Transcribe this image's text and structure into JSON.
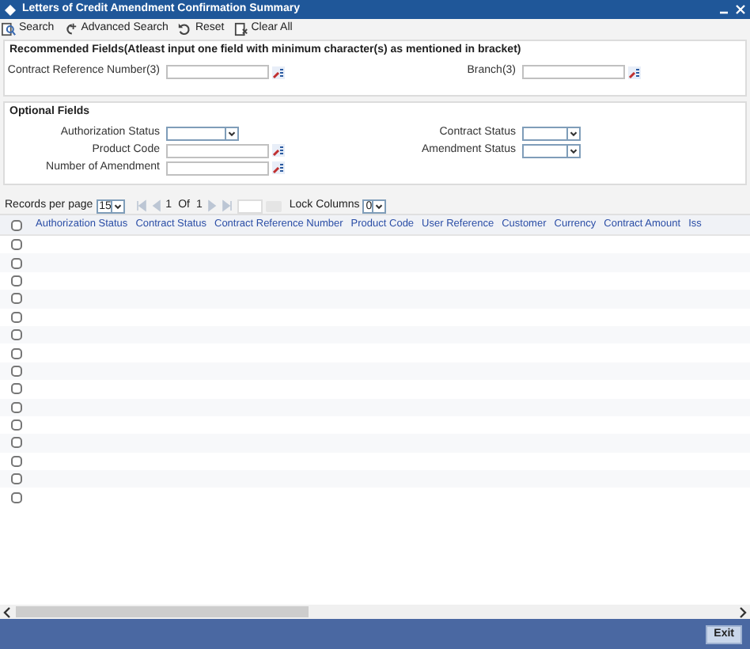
{
  "window": {
    "title": "Letters of Credit Amendment Confirmation Summary"
  },
  "toolbar": [
    {
      "label": "Search",
      "kind": "search"
    },
    {
      "label": "Advanced Search",
      "kind": "advanced"
    },
    {
      "label": "Reset",
      "kind": "reset"
    },
    {
      "label": "Clear All",
      "kind": "clear"
    }
  ],
  "recommended": {
    "title": "Recommended Fields(Atleast input one field with minimum character(s) as mentioned in bracket)",
    "left": [
      {
        "label": "Contract Reference Number(3)",
        "kind": "lookup"
      }
    ],
    "right": [
      {
        "label": "Branch(3)",
        "kind": "lookup"
      }
    ]
  },
  "optional": {
    "title": "Optional Fields",
    "left": [
      {
        "label": "Authorization Status",
        "kind": "select"
      },
      {
        "label": "Product Code",
        "kind": "lookup"
      },
      {
        "label": "Number of Amendment",
        "kind": "lookup"
      }
    ],
    "right": [
      {
        "label": "Contract Status",
        "kind": "select"
      },
      {
        "label": "Amendment Status",
        "kind": "select"
      }
    ]
  },
  "pagination": {
    "records_label": "Records per page",
    "per_page": "15",
    "page": "1",
    "of_label": "Of",
    "total": "1",
    "lock_label": "Lock Columns",
    "lock_value": "0"
  },
  "table": {
    "columns": [
      "Authorization Status",
      "Contract Status",
      "Contract Reference Number",
      "Product Code",
      "User Reference",
      "Customer",
      "Currency",
      "Contract Amount",
      "Iss"
    ],
    "select_all_checked": false,
    "rows": [
      {
        "checked": false
      },
      {
        "checked": false
      },
      {
        "checked": false
      },
      {
        "checked": false
      },
      {
        "checked": false
      },
      {
        "checked": false
      },
      {
        "checked": false
      },
      {
        "checked": false
      },
      {
        "checked": false
      },
      {
        "checked": false
      },
      {
        "checked": false
      },
      {
        "checked": false
      },
      {
        "checked": false
      },
      {
        "checked": false
      },
      {
        "checked": false
      }
    ]
  },
  "footer": {
    "exit": "Exit"
  }
}
